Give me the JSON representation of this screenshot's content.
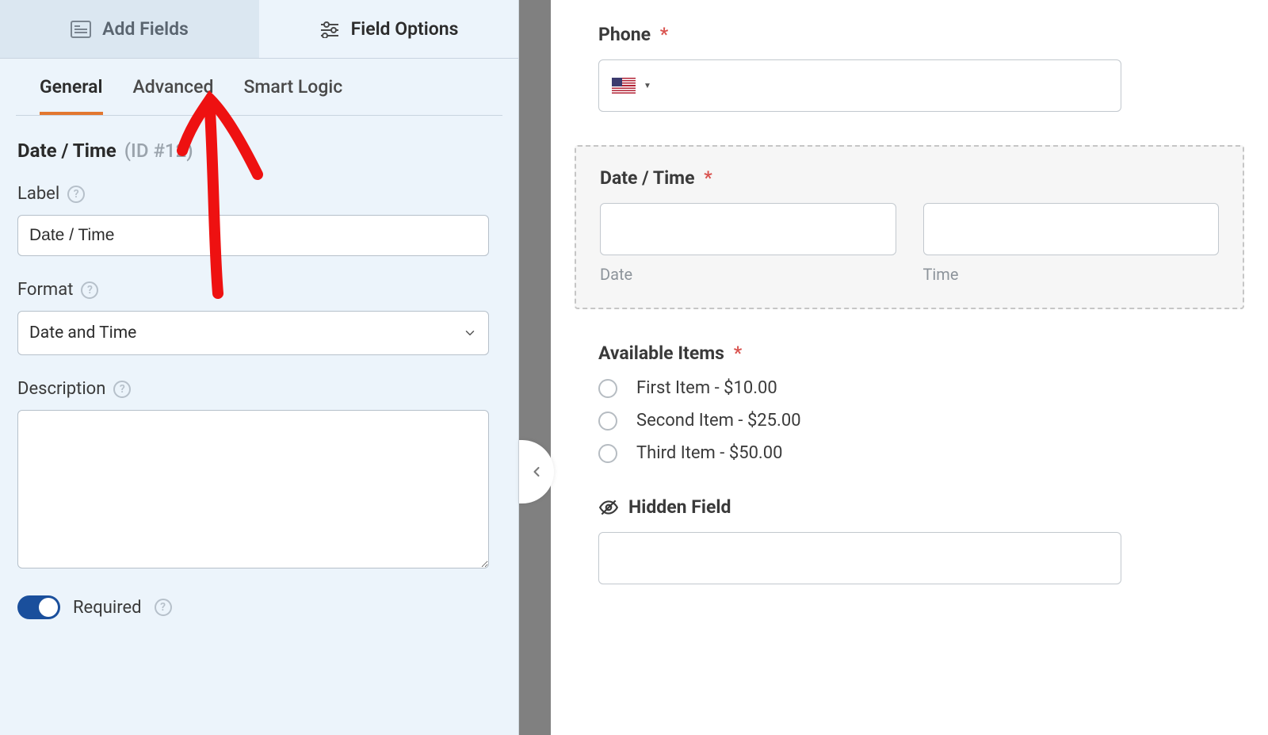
{
  "topTabs": {
    "addFields": "Add Fields",
    "fieldOptions": "Field Options"
  },
  "subTabs": {
    "general": "General",
    "advanced": "Advanced",
    "smartLogic": "Smart Logic"
  },
  "fieldHeader": {
    "name": "Date / Time",
    "id": "(ID #12)"
  },
  "labelSection": {
    "label": "Label",
    "value": "Date / Time"
  },
  "formatSection": {
    "label": "Format",
    "value": "Date and Time"
  },
  "descriptionSection": {
    "label": "Description",
    "value": ""
  },
  "requiredRow": {
    "label": "Required"
  },
  "preview": {
    "phone": {
      "label": "Phone",
      "value": ""
    },
    "datetime": {
      "label": "Date / Time",
      "dateSub": "Date",
      "timeSub": "Time"
    },
    "items": {
      "label": "Available Items",
      "options": [
        "First Item - $10.00",
        "Second Item - $25.00",
        "Third Item - $50.00"
      ]
    },
    "hidden": {
      "label": "Hidden Field",
      "value": ""
    }
  }
}
